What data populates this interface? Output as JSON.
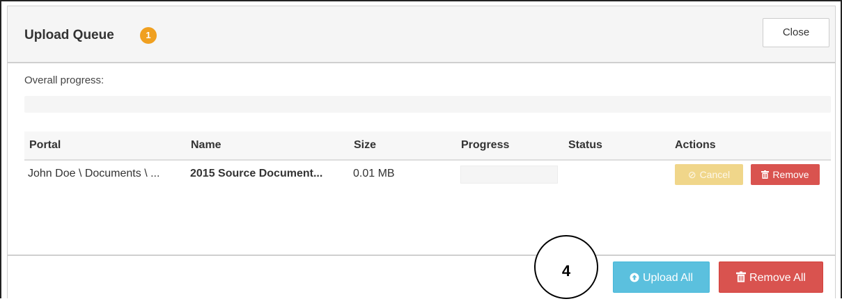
{
  "dialog": {
    "title": "Upload Queue",
    "badge_count": "1",
    "close_label": "Close"
  },
  "overall": {
    "label": "Overall progress:",
    "progress_percent": 0
  },
  "table": {
    "headers": [
      "Portal",
      "Name",
      "Size",
      "Progress",
      "Status",
      "Actions"
    ],
    "rows": [
      {
        "portal": "John Doe \\ Documents \\ ...",
        "name": "2015 Source Document...",
        "size": "0.01 MB",
        "progress_percent": 0,
        "status": "",
        "cancel_label": "Cancel",
        "remove_label": "Remove"
      }
    ]
  },
  "footer": {
    "step_number": "4",
    "upload_all_label": "Upload All",
    "remove_all_label": "Remove All"
  },
  "icons": {
    "cancel": "ban-icon",
    "remove": "trash-icon",
    "upload_all": "circle-arrow-up-icon",
    "remove_all": "trash-icon"
  },
  "colors": {
    "badge": "#f0a020",
    "info": "#5bc0de",
    "danger": "#d9534f",
    "warning_disabled": "#f0d68a"
  }
}
